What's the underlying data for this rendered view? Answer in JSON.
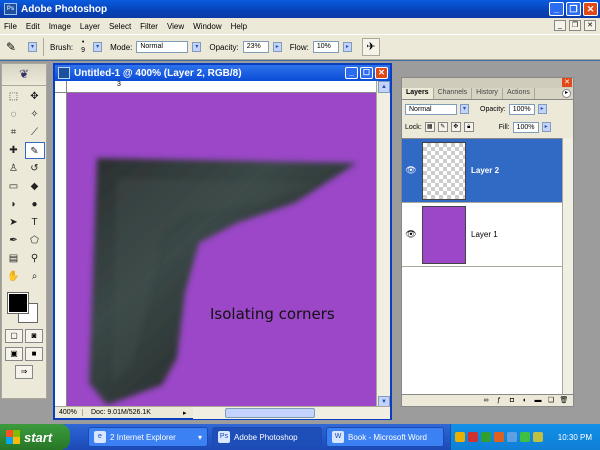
{
  "app": {
    "title": "Adobe Photoshop"
  },
  "menu": [
    "File",
    "Edit",
    "Image",
    "Layer",
    "Select",
    "Filter",
    "View",
    "Window",
    "Help"
  ],
  "options": {
    "brush_label": "Brush:",
    "brush_size": "9",
    "mode_label": "Mode:",
    "mode_value": "Normal",
    "opacity_label": "Opacity:",
    "opacity_value": "23%",
    "flow_label": "Flow:",
    "flow_value": "10%"
  },
  "document": {
    "title": "Untitled-1 @ 400% (Layer 2, RGB/8)",
    "ruler_mark": "3",
    "canvas_text": "Isolating corners",
    "canvas_color": "#9b47c8",
    "zoom": "400%",
    "doc_info": "Doc: 9.01M/526.1K"
  },
  "layers_panel": {
    "tabs": [
      "Layers",
      "Channels",
      "History",
      "Actions"
    ],
    "blend_mode": "Normal",
    "opacity_label": "Opacity:",
    "opacity_value": "100%",
    "lock_label": "Lock:",
    "fill_label": "Fill:",
    "fill_value": "100%",
    "layers": [
      {
        "name": "Layer 2",
        "active": true
      },
      {
        "name": "Layer 1",
        "active": false
      }
    ]
  },
  "taskbar": {
    "start_label": "start",
    "tasks": [
      "2 Internet Explorer",
      "Adobe Photoshop",
      "Book - Microsoft Word"
    ],
    "clock": "10:30 PM"
  }
}
